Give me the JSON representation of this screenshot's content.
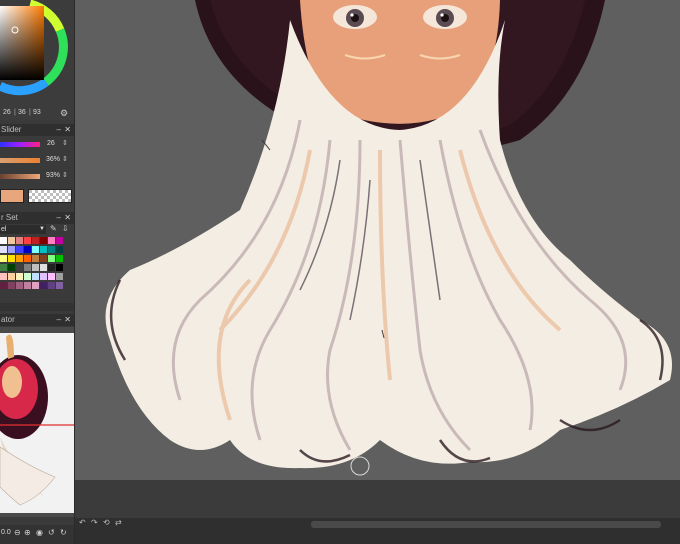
{
  "color_wheel": {
    "values": {
      "h": "26",
      "s": "36",
      "v": "93"
    },
    "settings_icon": "gear-icon"
  },
  "color_slider": {
    "title": "Slider",
    "rows": [
      {
        "value": "26",
        "color": "#6b5cff"
      },
      {
        "value": "36%",
        "color": "#f0a060"
      },
      {
        "value": "93%",
        "color": "#f0a070"
      }
    ],
    "main_color": "#e8a67c"
  },
  "color_set": {
    "title": "r Set",
    "selector": "el",
    "swatches": [
      "#ffffff",
      "#f0c8a0",
      "#e08080",
      "#ff4040",
      "#c02020",
      "#800000",
      "#ff80c0",
      "#c000a0",
      "#e0e0ff",
      "#a0a0ff",
      "#4040ff",
      "#0000c0",
      "#80ffff",
      "#00c0c0",
      "#008080",
      "#004040",
      "#ffff80",
      "#ffe000",
      "#ffa000",
      "#ff6000",
      "#c08040",
      "#804020",
      "#80ff80",
      "#00c000",
      "#408040",
      "#004000",
      "#404040",
      "#808080",
      "#c0c0c0",
      "#e0e0e0",
      "#202020",
      "#000000",
      "#ffc0c0",
      "#ffd0a0",
      "#fff0c0",
      "#d0ffd0",
      "#c0e0ff",
      "#e0c0ff",
      "#ffc0ff",
      "#a0a0a0",
      "#602040",
      "#804060",
      "#a06080",
      "#c080a0",
      "#e0a0c0",
      "#402060",
      "#604080",
      "#8060a0"
    ]
  },
  "navigator": {
    "title": "ator",
    "zoom": "0.0"
  },
  "status_icons": [
    "undo-icon",
    "redo-icon",
    "rotate-icon",
    "flip-icon"
  ],
  "colors": {
    "canvas": "#5f5f5f",
    "panel": "#3a3a3a",
    "hair_light": "#f6eee4",
    "skin": "#e8a07a",
    "dark_back": "#2a121a"
  }
}
